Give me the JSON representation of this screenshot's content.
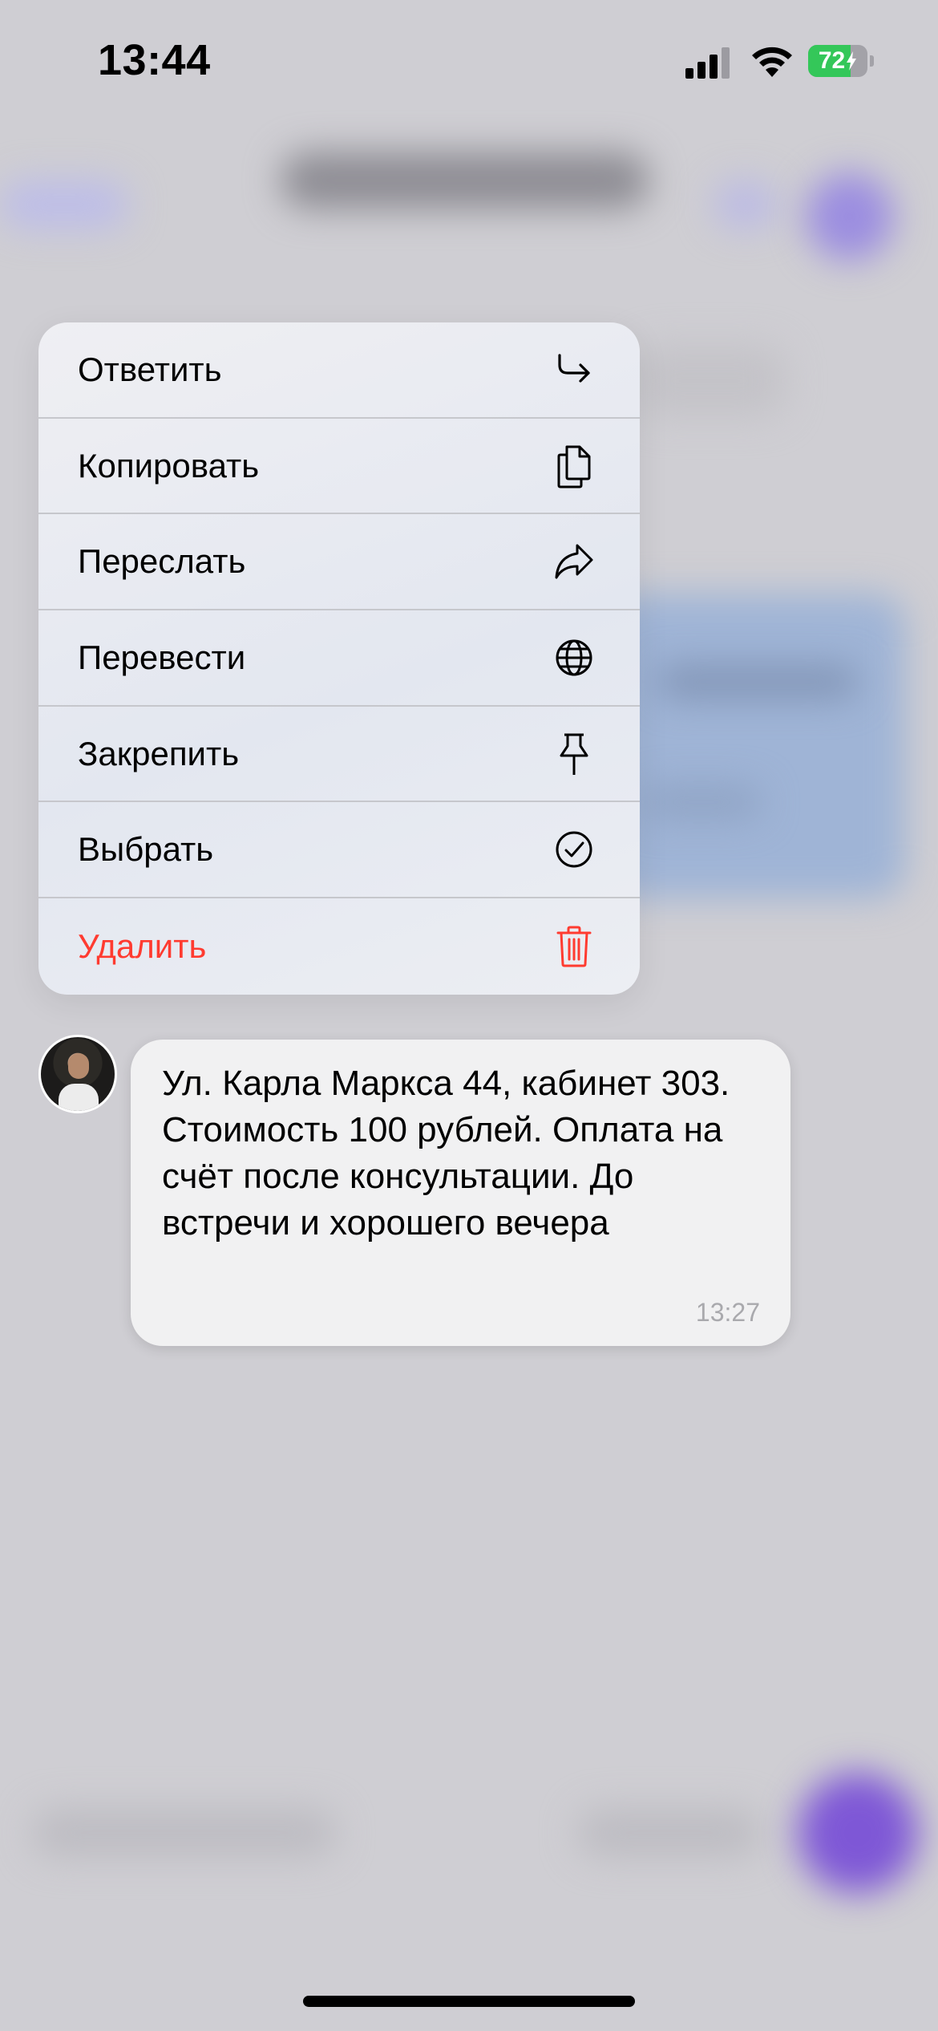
{
  "status_bar": {
    "time": "13:44",
    "battery_percent": "72",
    "battery_level": 0.72,
    "battery_color": "#34c759"
  },
  "context_menu": {
    "items": [
      {
        "label": "Ответить",
        "icon": "reply-icon"
      },
      {
        "label": "Копировать",
        "icon": "copy-icon"
      },
      {
        "label": "Переслать",
        "icon": "forward-icon"
      },
      {
        "label": "Перевести",
        "icon": "globe-icon"
      },
      {
        "label": "Закрепить",
        "icon": "pin-icon"
      },
      {
        "label": "Выбрать",
        "icon": "checkmark-circle-icon"
      },
      {
        "label": "Удалить",
        "icon": "trash-icon",
        "destructive": true,
        "color": "#ff3b30"
      }
    ]
  },
  "message": {
    "text": "Ул. Карла Маркса 44, кабинет 303.\nСтоимость 100 рублей. Оплата на счёт после консультации. До встречи и хорошего вечера",
    "time": "13:27"
  }
}
